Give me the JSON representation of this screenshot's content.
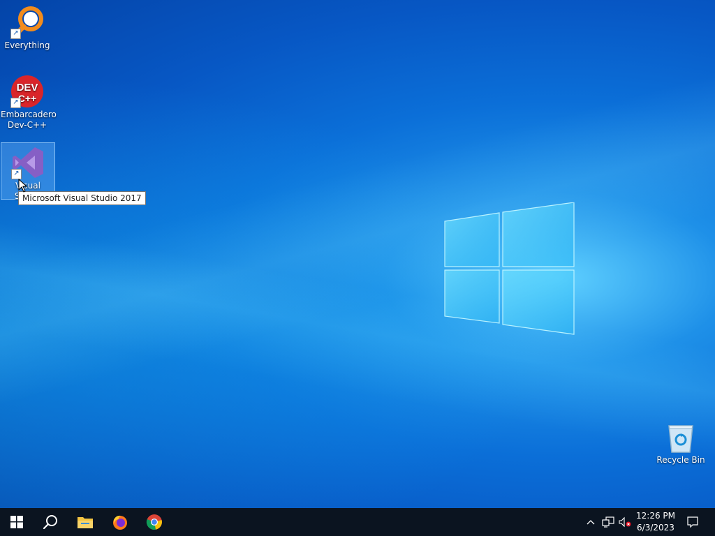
{
  "desktop": {
    "icons": [
      {
        "label": "Everything",
        "icon": "everything-icon"
      },
      {
        "label_line1": "Embarcadero",
        "label_line2": "Dev-C++",
        "icon": "devcpp-icon",
        "badge": "DEV\nC++"
      },
      {
        "label": "Visual Studio",
        "icon": "visual-studio-icon",
        "selected": true
      },
      {
        "label": "Recycle Bin",
        "icon": "recycle-bin-icon"
      }
    ],
    "tooltip": "Microsoft Visual Studio 2017",
    "devcpp_badge_top": "DEV",
    "devcpp_badge_bottom": "C++"
  },
  "taskbar": {
    "items": [
      {
        "name": "start",
        "icon": "windows-start-icon"
      },
      {
        "name": "search",
        "icon": "search-icon"
      },
      {
        "name": "file-explorer",
        "icon": "folder-icon"
      },
      {
        "name": "firefox",
        "icon": "firefox-icon"
      },
      {
        "name": "chrome",
        "icon": "chrome-icon"
      }
    ],
    "tray": {
      "show_hidden": "^",
      "icons": [
        "chevron-up-icon",
        "network-icon",
        "volume-muted-icon"
      ],
      "time": "12:26 PM",
      "date": "6/3/2023",
      "notification_icon": "action-center-icon"
    }
  },
  "colors": {
    "desktop_blue": "#0b6fd8",
    "taskbar": "#0b1420",
    "devcpp_red": "#d9252a",
    "vs_purple": "#865fc5",
    "everything_orange": "#f28c1c"
  }
}
